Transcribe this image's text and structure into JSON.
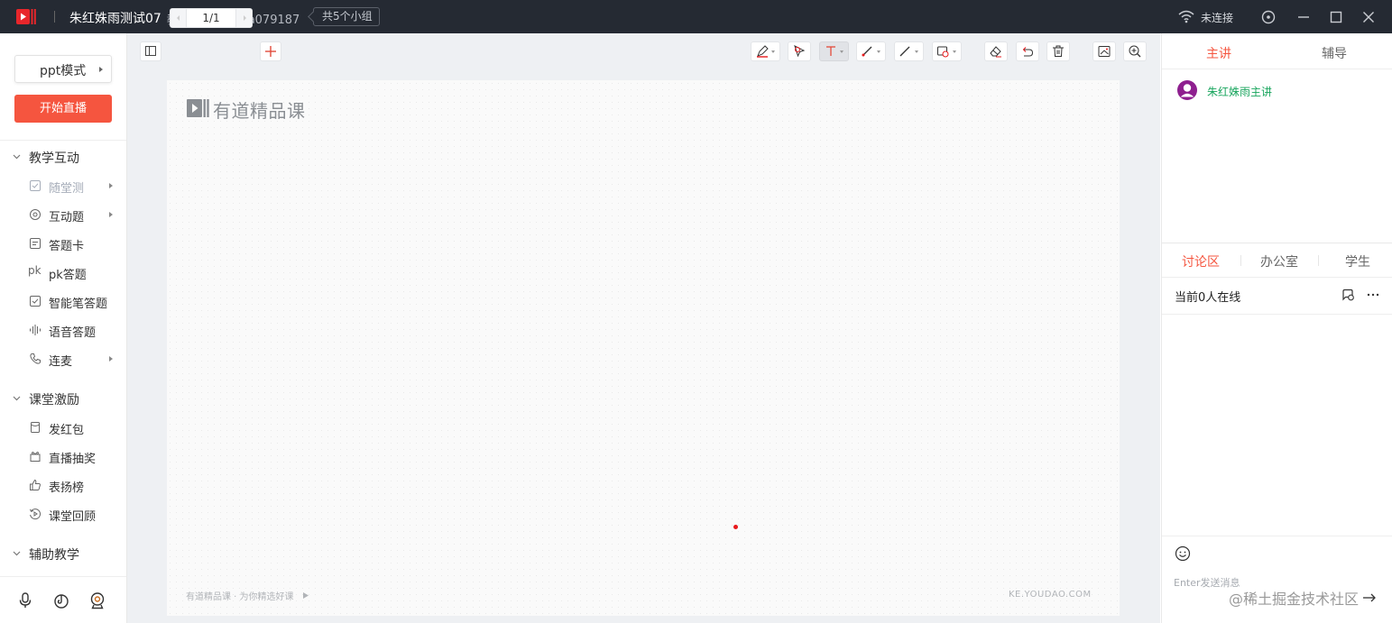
{
  "titlebar": {
    "title": "朱红姝雨测试07",
    "room_id": "教室ID:  1b537a079187",
    "groups": "共5个小组",
    "connection": "未连接"
  },
  "sidebar": {
    "mode": "ppt模式",
    "start_live": "开始直播",
    "sections": [
      {
        "label": "教学互动",
        "items": [
          {
            "label": "随堂测",
            "icon": "checkbox-icon",
            "disabled": true,
            "submenu": true
          },
          {
            "label": "互动题",
            "icon": "interactive-icon",
            "submenu": true
          },
          {
            "label": "答题卡",
            "icon": "answer-card-icon"
          },
          {
            "label": "pk答题",
            "icon": "pk-icon",
            "icon_text": "pk"
          },
          {
            "label": "智能笔答题",
            "icon": "smart-pen-icon"
          },
          {
            "label": "语音答题",
            "icon": "voice-wave-icon"
          },
          {
            "label": "连麦",
            "icon": "phone-icon",
            "submenu": true
          }
        ]
      },
      {
        "label": "课堂激励",
        "items": [
          {
            "label": "发红包",
            "icon": "red-packet-icon"
          },
          {
            "label": "直播抽奖",
            "icon": "lottery-icon"
          },
          {
            "label": "表扬榜",
            "icon": "thumbs-up-icon"
          },
          {
            "label": "课堂回顾",
            "icon": "replay-icon"
          }
        ]
      },
      {
        "label": "辅助教学",
        "items": []
      }
    ]
  },
  "toolbar": {
    "page": "1/1"
  },
  "slide": {
    "brand": "有道精品课",
    "footer_left": "有道精品课 · 为你精选好课",
    "footer_right": "KE.YOUDAO.COM"
  },
  "right": {
    "tabs": [
      "主讲",
      "辅导"
    ],
    "host_name": "朱红姝雨主讲",
    "discussion_tabs": [
      "讨论区",
      "办公室",
      "学生"
    ],
    "online": "当前0人在线",
    "input_placeholder": "Enter发送消息"
  },
  "watermark": "@稀土掘金技术社区",
  "colors": {
    "accent": "#f5553f",
    "titlebar": "#252a33",
    "host_green": "#18a55d"
  }
}
